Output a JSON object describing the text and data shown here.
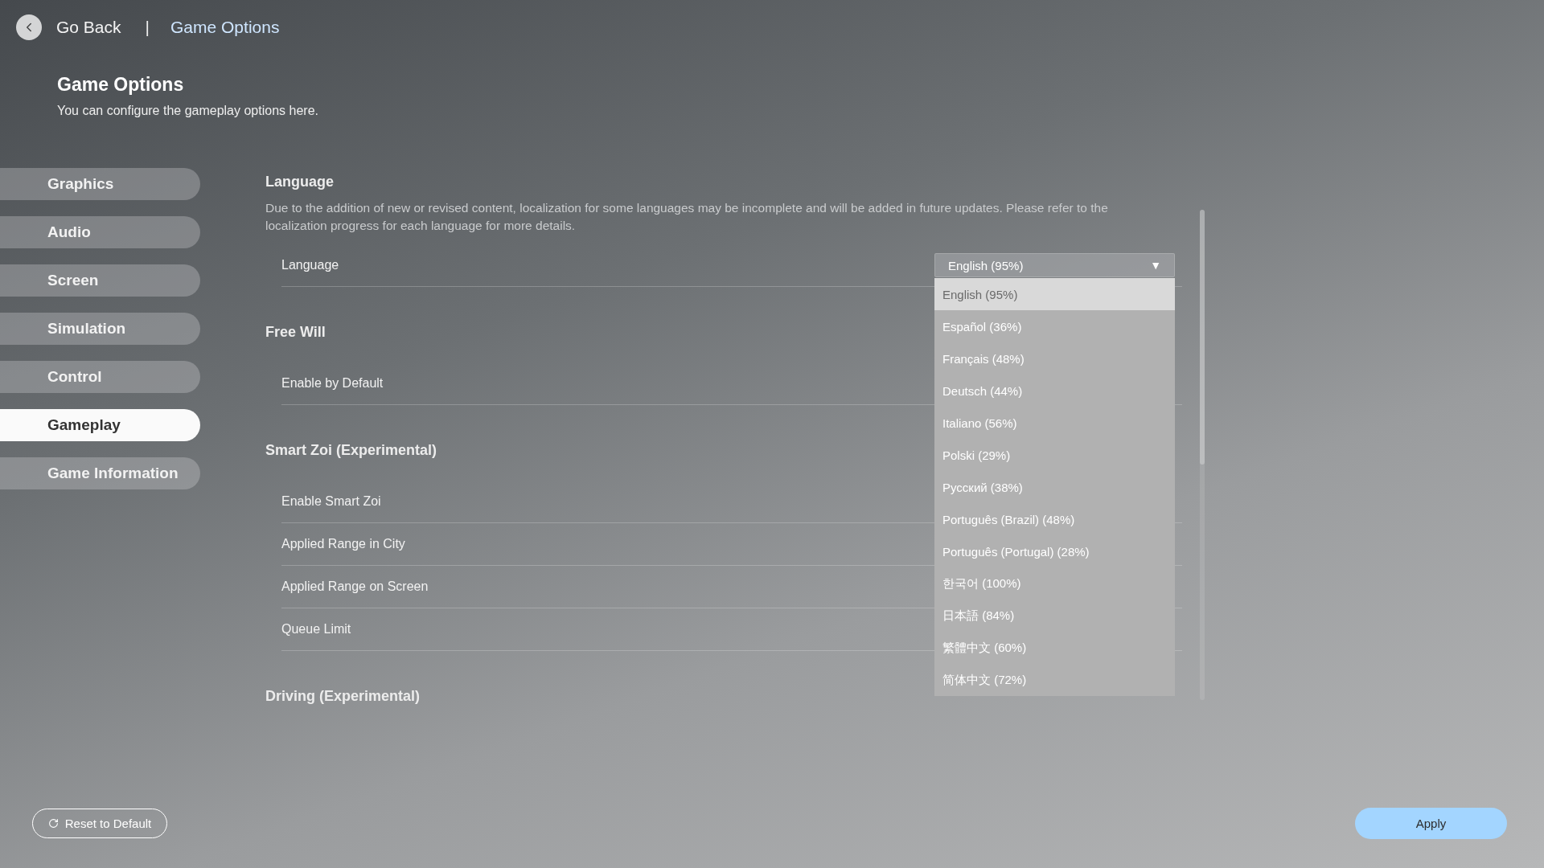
{
  "header": {
    "back_label": "Go Back",
    "separator": "|",
    "breadcrumb": "Game Options"
  },
  "page": {
    "title": "Game Options",
    "subtitle": "You can configure the gameplay options here."
  },
  "sidebar": {
    "items": [
      {
        "label": "Graphics",
        "selected": false
      },
      {
        "label": "Audio",
        "selected": false
      },
      {
        "label": "Screen",
        "selected": false
      },
      {
        "label": "Simulation",
        "selected": false
      },
      {
        "label": "Control",
        "selected": false
      },
      {
        "label": "Gameplay",
        "selected": true
      },
      {
        "label": "Game Information",
        "selected": false
      }
    ]
  },
  "sections": [
    {
      "title": "Language",
      "description": "Due to the addition of new or revised content, localization for some languages may be incomplete and will be added in future updates. Please refer to the localization progress for each language for more details.",
      "rows": [
        {
          "label": "Language",
          "kind": "dropdown"
        }
      ]
    },
    {
      "title": "Free Will",
      "rows": [
        {
          "label": "Enable by Default",
          "kind": "plain"
        }
      ]
    },
    {
      "title": "Smart Zoi (Experimental)",
      "rows": [
        {
          "label": "Enable Smart Zoi",
          "kind": "plain"
        },
        {
          "label": "Applied Range in City",
          "kind": "plain"
        },
        {
          "label": "Applied Range on Screen",
          "kind": "plain"
        },
        {
          "label": "Queue Limit",
          "kind": "plain"
        }
      ]
    },
    {
      "title": "Driving (Experimental)"
    }
  ],
  "dropdown": {
    "value": "English (95%)",
    "arrow": "▼",
    "options": [
      {
        "label": "English (95%)",
        "selected": true
      },
      {
        "label": "Español (36%)",
        "selected": false
      },
      {
        "label": "Français (48%)",
        "selected": false
      },
      {
        "label": "Deutsch (44%)",
        "selected": false
      },
      {
        "label": "Italiano (56%)",
        "selected": false
      },
      {
        "label": "Polski (29%)",
        "selected": false
      },
      {
        "label": "Русский (38%)",
        "selected": false
      },
      {
        "label": "Português (Brazil) (48%)",
        "selected": false
      },
      {
        "label": "Português (Portugal) (28%)",
        "selected": false
      },
      {
        "label": "한국어 (100%)",
        "selected": false
      },
      {
        "label": "日本語 (84%)",
        "selected": false
      },
      {
        "label": "繁體中文 (60%)",
        "selected": false
      },
      {
        "label": "简体中文 (72%)",
        "selected": false
      }
    ]
  },
  "footer": {
    "reset_label": "Reset to Default",
    "apply_label": "Apply"
  }
}
